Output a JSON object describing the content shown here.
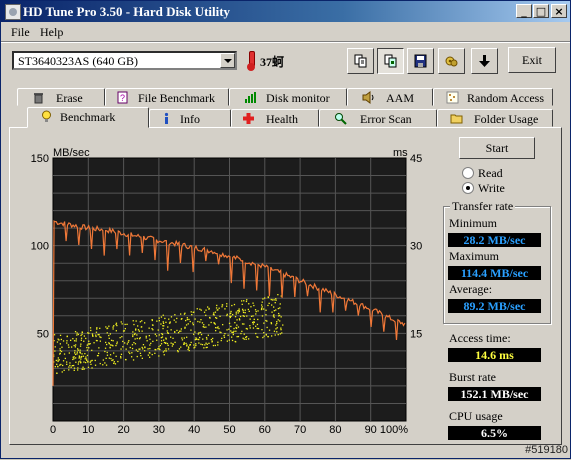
{
  "window": {
    "title": "HD Tune Pro 3.50 - Hard Disk Utility",
    "minimize": "_",
    "maximize": "□",
    "close": "×"
  },
  "menu": [
    "File",
    "Help"
  ],
  "toolbar": {
    "drive": "ST3640323AS (640 GB)",
    "temperature": "37蚵",
    "exit_label": "Exit",
    "buttons": [
      "copy-info-icon",
      "copy-screenshot-icon",
      "save-icon",
      "options-icon",
      "down-arrow-icon"
    ]
  },
  "tabs_row1": [
    "Erase",
    "File Benchmark",
    "Disk monitor",
    "AAM",
    "Random Access"
  ],
  "tabs_row2": [
    "Benchmark",
    "Info",
    "Health",
    "Error Scan",
    "Folder Usage"
  ],
  "active_tab": "Benchmark",
  "controls": {
    "start_label": "Start",
    "read_label": "Read",
    "write_label": "Write",
    "selected_mode": "Write"
  },
  "results": {
    "group_title": "Transfer rate",
    "min_label": "Minimum",
    "min_value": "28.2 MB/sec",
    "max_label": "Maximum",
    "max_value": "114.4 MB/sec",
    "avg_label": "Average:",
    "avg_value": "89.2 MB/sec",
    "access_label": "Access time:",
    "access_value": "14.6 ms",
    "burst_label": "Burst rate",
    "burst_value": "152.1 MB/sec",
    "cpu_label": "CPU usage",
    "cpu_value": "6.5%"
  },
  "watermark": "#519180",
  "chart_data": {
    "type": "line",
    "y_left_unit": "MB/sec",
    "y_right_unit": "ms",
    "ylim": [
      0,
      150
    ],
    "y2lim": [
      0,
      45
    ],
    "y_ticks": [
      "150",
      "100",
      "50"
    ],
    "y2_ticks": [
      "45",
      "30",
      "15"
    ],
    "x_ticks": [
      "0",
      "10",
      "20",
      "30",
      "40",
      "50",
      "60",
      "70",
      "80",
      "90",
      "100%"
    ],
    "grid": true,
    "colors": {
      "background": "#1c1c1c",
      "grid": "#555555",
      "transfer": "#f07838",
      "access": "#f0f020"
    },
    "series": [
      {
        "x": [
          0,
          2,
          5,
          10,
          15,
          20,
          25,
          30,
          35,
          40,
          45,
          50,
          55,
          60,
          65,
          70,
          75,
          80,
          85,
          90,
          95,
          100
        ],
        "values": [
          114,
          113,
          112,
          110,
          109,
          107,
          105,
          103,
          101,
          99,
          97,
          94,
          91,
          88,
          84,
          80,
          76,
          72,
          68,
          64,
          59,
          55
        ]
      }
    ],
    "scatter_range": {
      "x": [
        0,
        65
      ],
      "ms_low_start": 8,
      "ms_high_start": 15,
      "ms_low_end": 15,
      "ms_high_end": 22
    }
  }
}
